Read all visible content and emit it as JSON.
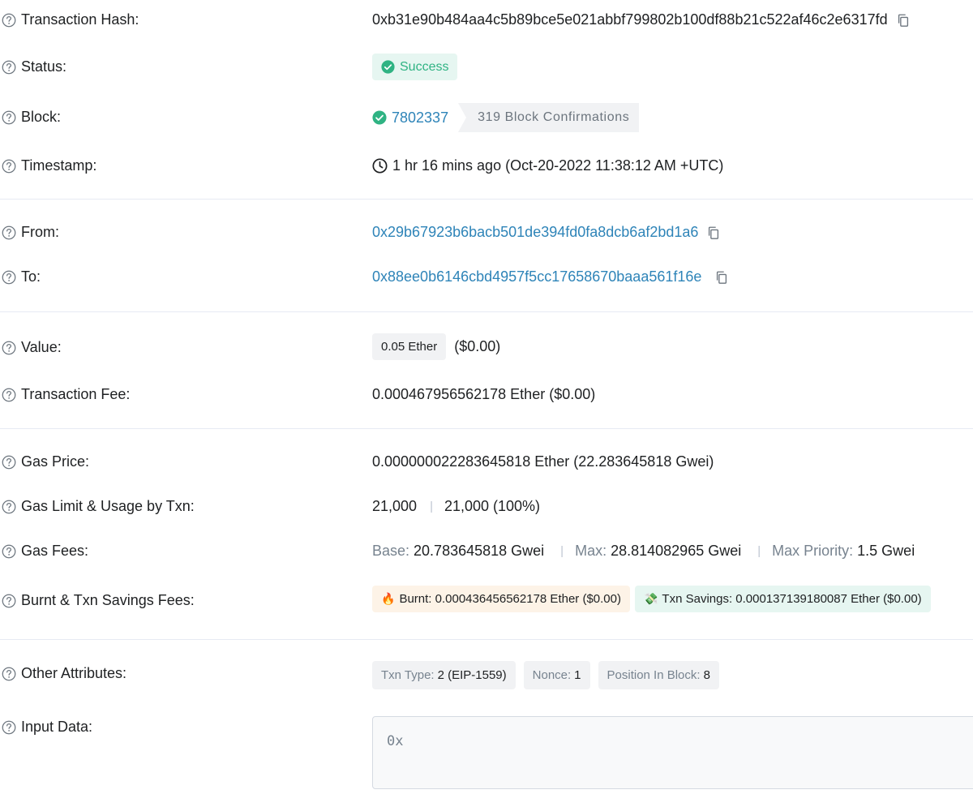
{
  "rows": {
    "hash": {
      "label": "Transaction Hash:",
      "value": "0xb31e90b484aa4c5b89bce5e021abbf799802b100df88b21c522af46c2e6317fd"
    },
    "status": {
      "label": "Status:",
      "value": "Success"
    },
    "block": {
      "label": "Block:",
      "number": "7802337",
      "confirmations": "319 Block Confirmations"
    },
    "timestamp": {
      "label": "Timestamp:",
      "value": "1 hr 16 mins ago (Oct-20-2022 11:38:12 AM +UTC)"
    },
    "from": {
      "label": "From:",
      "value": "0x29b67923b6bacb501de394fd0fa8dcb6af2bd1a6"
    },
    "to": {
      "label": "To:",
      "value": "0x88ee0b6146cbd4957f5cc17658670baaa561f16e"
    },
    "value": {
      "label": "Value:",
      "amount": "0.05 Ether",
      "usd": "($0.00)"
    },
    "fee": {
      "label": "Transaction Fee:",
      "value": "0.000467956562178 Ether ($0.00)"
    },
    "gas_price": {
      "label": "Gas Price:",
      "value": "0.000000022283645818 Ether (22.283645818 Gwei)"
    },
    "gas_limit": {
      "label": "Gas Limit & Usage by Txn:",
      "limit": "21,000",
      "sep": "|",
      "usage": "21,000 (100%)"
    },
    "gas_fees": {
      "label": "Gas Fees:",
      "base_key": "Base:",
      "base_val": "20.783645818 Gwei",
      "sep": "|",
      "max_key": "Max:",
      "max_val": "28.814082965 Gwei",
      "prio_key": "Max Priority:",
      "prio_val": "1.5 Gwei"
    },
    "burnt": {
      "label": "Burnt & Txn Savings Fees:",
      "burnt_emoji": "🔥",
      "burnt": "Burnt: 0.000436456562178 Ether ($0.00)",
      "savings_emoji": "💸",
      "savings": "Txn Savings: 0.000137139180087 Ether ($0.00)"
    },
    "attributes": {
      "label": "Other Attributes:",
      "items": [
        {
          "key": "Txn Type:",
          "value": "2 (EIP-1559)"
        },
        {
          "key": "Nonce:",
          "value": "1"
        },
        {
          "key": "Position In Block:",
          "value": "8"
        }
      ]
    },
    "input": {
      "label": "Input Data:",
      "value": "0x"
    }
  },
  "colors": {
    "link": "#2e84b8",
    "success": "#2fb383",
    "muted": "#77838f"
  },
  "icons": [
    "question-circle-icon",
    "copy-icon",
    "check-circle-icon",
    "clock-icon"
  ]
}
